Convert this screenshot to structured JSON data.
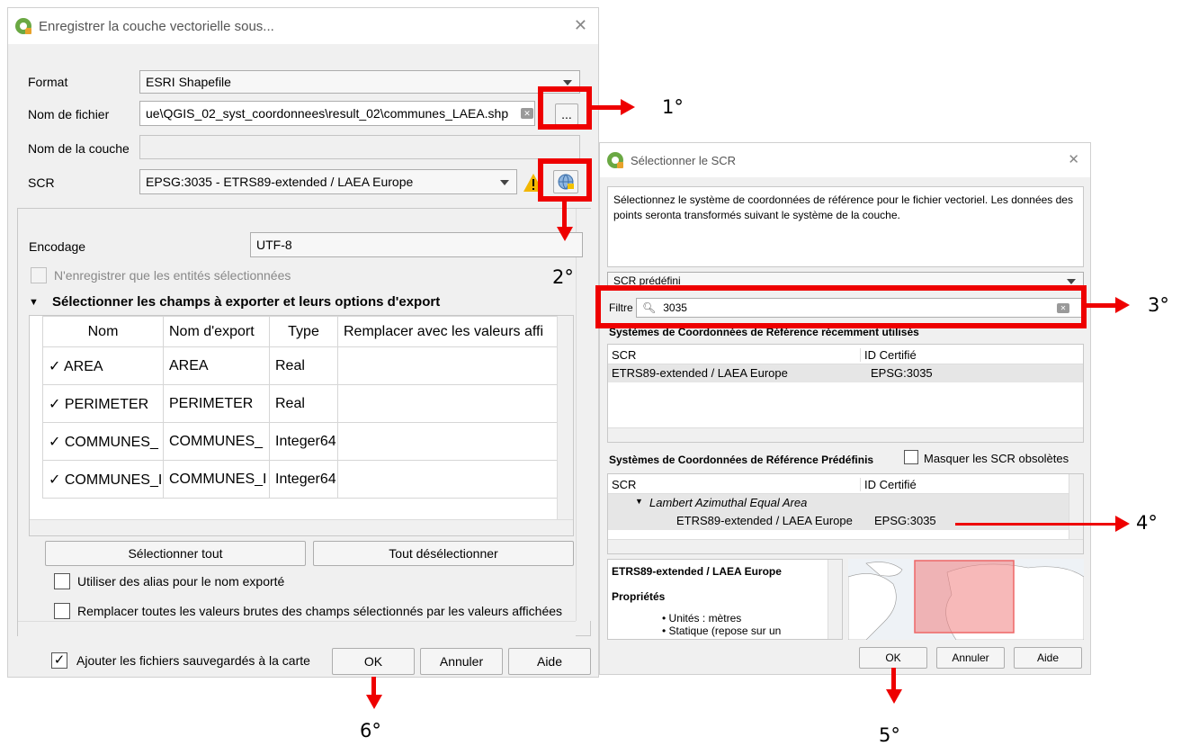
{
  "save_dialog": {
    "title": "Enregistrer la couche vectorielle sous...",
    "format_label": "Format",
    "format_value": "ESRI Shapefile",
    "filename_label": "Nom de fichier",
    "filename_value": "ue\\QGIS_02_syst_coordonnees\\result_02\\communes_LAEA.shp",
    "browse_label": "...",
    "layername_label": "Nom de la couche",
    "layername_value": "",
    "crs_label": "SCR",
    "crs_value": "EPSG:3035 - ETRS89-extended / LAEA Europe",
    "encoding_label": "Encodage",
    "encoding_value": "UTF-8",
    "selected_only_label": "N'enregistrer que les entités sélectionnées",
    "fields_section_label": "Sélectionner les champs à exporter et leurs options d'export",
    "columns": [
      "Nom",
      "Nom d'export",
      "Type",
      "Remplacer avec les valeurs affi"
    ],
    "rows": [
      {
        "name": "AREA",
        "export": "AREA",
        "type": "Real"
      },
      {
        "name": "PERIMETER",
        "export": "PERIMETER",
        "type": "Real"
      },
      {
        "name": "COMMUNES_",
        "export": "COMMUNES_",
        "type": "Integer64"
      },
      {
        "name": "COMMUNES_I",
        "export": "COMMUNES_I",
        "type": "Integer64"
      }
    ],
    "select_all_label": "Sélectionner tout",
    "deselect_all_label": "Tout désélectionner",
    "use_alias_label": "Utiliser des alias pour le nom exporté",
    "replace_values_label": "Remplacer toutes les valeurs brutes des champs sélectionnés par les valeurs affichées",
    "add_to_map_label": "Ajouter les fichiers sauvegardés à la carte",
    "ok_label": "OK",
    "cancel_label": "Annuler",
    "help_label": "Aide"
  },
  "crs_dialog": {
    "title": "Sélectionner le SCR",
    "description": "Sélectionnez le système de coordonnées de référence pour le fichier vectoriel. Les données des points seronta transformés suivant le système de la couche.",
    "predefined_combo": "SCR prédéfini",
    "filter_label": "Filtre",
    "filter_value": "3035",
    "recent_header": "Systèmes de Coordonnées de Référence récemment utilisés",
    "col_scr": "SCR",
    "col_id": "ID Certifié",
    "recent_row_name": "ETRS89-extended / LAEA Europe",
    "recent_row_id": "EPSG:3035",
    "predefined_header": "Systèmes de Coordonnées de Référence Prédéfinis",
    "hide_obsolete_label": "Masquer les SCR obsolètes",
    "tree_group": "Lambert Azimuthal Equal Area",
    "tree_item_name": "ETRS89-extended / LAEA Europe",
    "tree_item_id": "EPSG:3035",
    "info_title": "ETRS89-extended / LAEA Europe",
    "info_props": "Propriétés",
    "info_units": "Unités : mètres",
    "info_static": "Statique (repose sur un",
    "ok_label": "OK",
    "cancel_label": "Annuler",
    "help_label": "Aide"
  },
  "annotations": [
    "1°",
    "2°",
    "3°",
    "4°",
    "5°",
    "6°"
  ]
}
